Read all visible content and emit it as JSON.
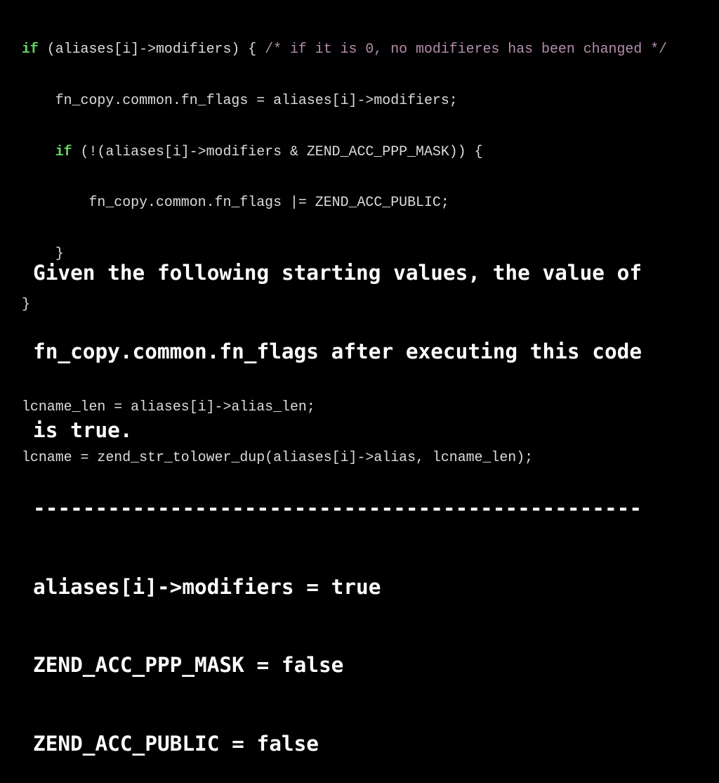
{
  "code": {
    "line1": {
      "kw": "if",
      "text": " (aliases[i]->modifiers) { ",
      "comment": "/* if it is 0, no modifieres has been changed */"
    },
    "line2": "    fn_copy.common.fn_flags = aliases[i]->modifiers;",
    "line3": {
      "indent": "    ",
      "kw": "if",
      "text": " (!(aliases[i]->modifiers & ZEND_ACC_PPP_MASK)) {"
    },
    "line4": "        fn_copy.common.fn_flags |= ZEND_ACC_PUBLIC;",
    "line5": "    }",
    "line6": "}",
    "line7": "",
    "line8": "lcname_len = aliases[i]->alias_len;",
    "line9": "lcname = zend_str_tolower_dup(aliases[i]->alias, lcname_len);"
  },
  "question": {
    "line1": "Given the following starting values, the value of",
    "line2": "fn_copy.common.fn_flags after executing this code",
    "line3": "is true.",
    "separator": "-------------------------------------------------",
    "values": [
      "aliases[i]->modifiers = true",
      "ZEND_ACC_PPP_MASK = false",
      "ZEND_ACC_PUBLIC = false"
    ]
  }
}
